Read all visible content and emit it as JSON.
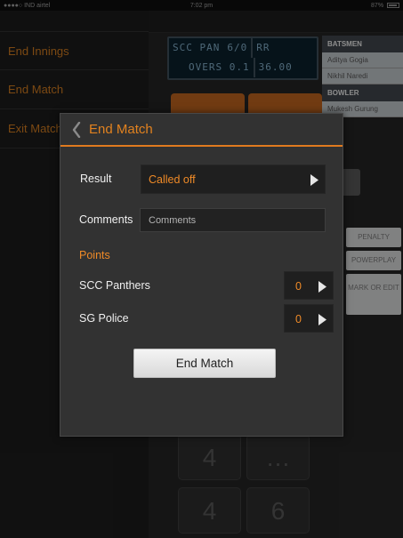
{
  "status_bar": {
    "carrier": "●●●●○ IND airtel",
    "time": "7:02 pm",
    "battery": "87%"
  },
  "side_menu": {
    "items": [
      {
        "label": "End Innings"
      },
      {
        "label": "End Match"
      },
      {
        "label": "Exit Match"
      }
    ]
  },
  "background": {
    "scoreboard": {
      "team": "SCC PAN",
      "score": "6/0",
      "rr_label": "RR",
      "overs": "OVERS 0.1",
      "rr_value": "36.00"
    },
    "batsmen_header": "BATSMEN",
    "batsmen": [
      "Aditya Gogia",
      "Nikhil Naredi"
    ],
    "bowler_header": "BOWLER",
    "bowler": "Mukesh Gurung",
    "side_keys": [
      "PENALTY",
      "POWERPLAY",
      "MARK OR EDIT"
    ],
    "num_keys": [
      "4",
      "…",
      "4",
      "6"
    ]
  },
  "modal": {
    "title": "End Match",
    "result_label": "Result",
    "result_value": "Called off",
    "comments_label": "Comments",
    "comments_value": "",
    "comments_placeholder": "Comments",
    "points_title": "Points",
    "teams": [
      {
        "name": "SCC Panthers",
        "points": "0"
      },
      {
        "name": "SG Police",
        "points": "0"
      }
    ],
    "end_button_label": "End Match"
  },
  "colors": {
    "accent": "#e2821f",
    "modal_bg": "#323232",
    "field_bg": "#1f1f1f"
  }
}
